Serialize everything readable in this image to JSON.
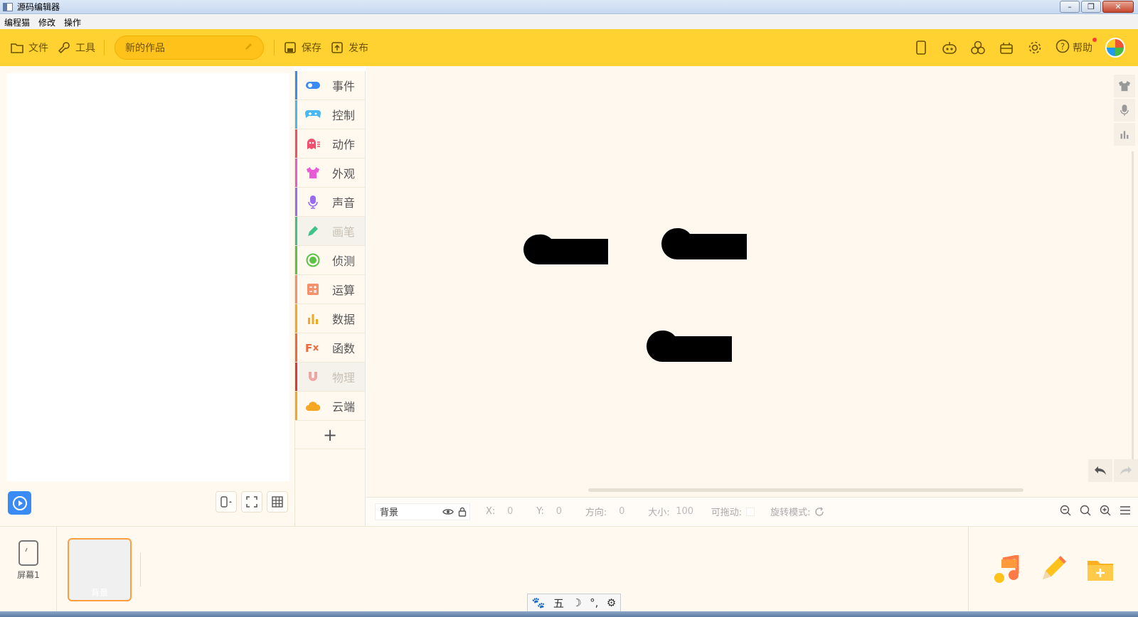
{
  "window": {
    "title": "源码编辑器",
    "buttons": [
      "–",
      "❐",
      "✕"
    ]
  },
  "menubar": {
    "items": [
      "编程猫",
      "修改",
      "操作"
    ]
  },
  "toolbar": {
    "file_label": "文件",
    "tools_label": "工具",
    "project_name": "新的作品",
    "save_label": "保存",
    "publish_label": "发布",
    "help_label": "帮助",
    "accent_color": "#ffd232"
  },
  "categories": [
    {
      "label": "事件",
      "color": "#3b8bf5",
      "icon": "toggle-icon",
      "dim": false
    },
    {
      "label": "控制",
      "color": "#49b8f0",
      "icon": "gamepad-icon",
      "dim": false
    },
    {
      "label": "动作",
      "color": "#f0506e",
      "icon": "ghost-icon",
      "dim": false
    },
    {
      "label": "外观",
      "color": "#e85ad6",
      "icon": "shirt-icon",
      "dim": false
    },
    {
      "label": "声音",
      "color": "#9b6cf0",
      "icon": "microphone-icon",
      "dim": false
    },
    {
      "label": "画笔",
      "color": "#3fc28a",
      "icon": "pen-icon",
      "dim": true
    },
    {
      "label": "侦测",
      "color": "#5cc246",
      "icon": "radar-icon",
      "dim": false
    },
    {
      "label": "运算",
      "color": "#f5916b",
      "icon": "calculator-icon",
      "dim": false
    },
    {
      "label": "数据",
      "color": "#f5a623",
      "icon": "bar-chart-icon",
      "dim": false
    },
    {
      "label": "函数",
      "color": "#f2683c",
      "icon": "function-icon",
      "dim": false
    },
    {
      "label": "物理",
      "color": "#e0373b",
      "icon": "magnet-icon",
      "dim": true
    },
    {
      "label": "云端",
      "color": "#f5a623",
      "icon": "cloud-icon",
      "dim": false
    }
  ],
  "add_category": "+",
  "properties": {
    "sprite_name": "背景",
    "x_label": "X:",
    "x_value": "0",
    "y_label": "Y:",
    "y_value": "0",
    "direction_label": "方向:",
    "direction_value": "0",
    "size_label": "大小:",
    "size_value": "100",
    "draggable_label": "可拖动:",
    "rotation_label": "旋转模式:"
  },
  "bottom": {
    "screen_label": "屏幕1",
    "background_label": "背景"
  },
  "ime": {
    "items": [
      "🐾",
      "五",
      "☽",
      "°,",
      "⚙"
    ]
  }
}
